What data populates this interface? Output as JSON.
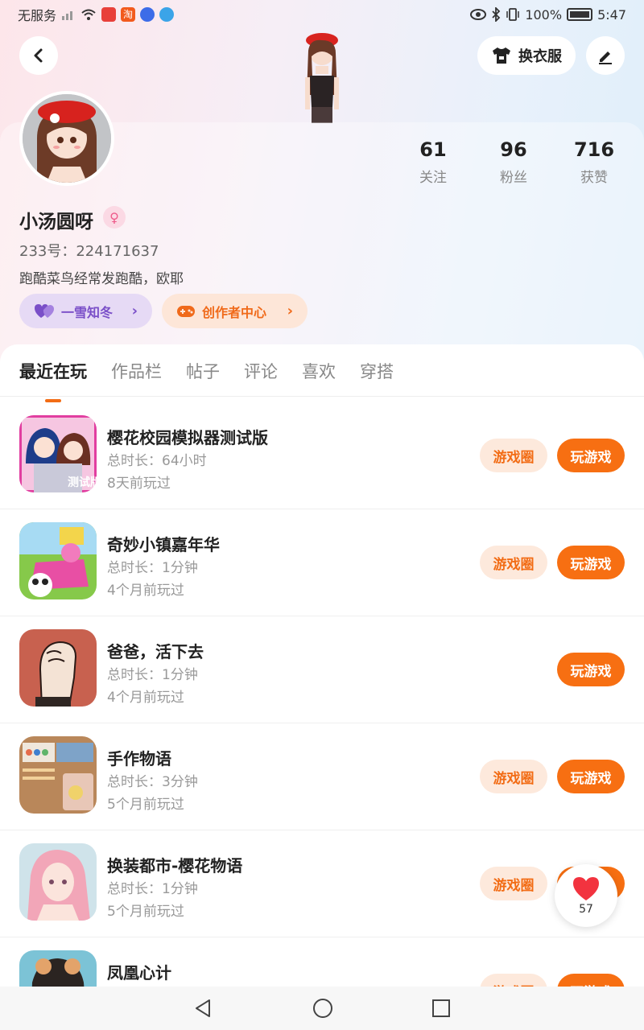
{
  "status_bar": {
    "carrier": "无服务",
    "taobao_glyph": "淘",
    "battery": "100%",
    "time": "5:47"
  },
  "header": {
    "outfit_label": "换衣服"
  },
  "profile": {
    "nickname": "小汤圆呀",
    "gender_symbol": "♀",
    "id_label": "233号：224171637",
    "bio": "跑酷菜鸟经常发跑酷，欧耶",
    "stats": [
      {
        "value": "61",
        "label": "关注"
      },
      {
        "value": "96",
        "label": "粉丝"
      },
      {
        "value": "716",
        "label": "获赞"
      }
    ],
    "fan_pill": "一雪知冬",
    "creator_pill": "创作者中心",
    "pill_arrow": "›"
  },
  "tabs": [
    "最近在玩",
    "作品栏",
    "帖子",
    "评论",
    "喜欢",
    "穿搭"
  ],
  "buttons": {
    "circle": "游戏圈",
    "play": "玩游戏"
  },
  "games": [
    {
      "name": "樱花校园模拟器测试版",
      "time": "总时长：64小时",
      "last": "8天前玩过",
      "has_circle": true,
      "icon_badge": "测试版"
    },
    {
      "name": "奇妙小镇嘉年华",
      "time": "总时长：1分钟",
      "last": "4个月前玩过",
      "has_circle": true
    },
    {
      "name": "爸爸，活下去",
      "time": "总时长：1分钟",
      "last": "4个月前玩过",
      "has_circle": false
    },
    {
      "name": "手作物语",
      "time": "总时长：3分钟",
      "last": "5个月前玩过",
      "has_circle": true
    },
    {
      "name": "换装都市-樱花物语",
      "time": "总时长：1分钟",
      "last": "5个月前玩过",
      "has_circle": true
    },
    {
      "name": "凤凰心计",
      "time": "",
      "last": "",
      "has_circle": true
    }
  ],
  "floating_like": {
    "count": "57"
  },
  "colors": {
    "accent": "#f76f12",
    "accent_light": "#fde9dc",
    "fan_purple": "#7a4fc8"
  },
  "icons": {
    "back": "back-icon",
    "outfit": "shirt-icon",
    "edit": "edit-icon",
    "heart": "heart-icon",
    "gamepad": "gamepad-icon",
    "nav_back": "nav-back-icon",
    "nav_home": "nav-home-icon",
    "nav_recent": "nav-recent-icon"
  }
}
